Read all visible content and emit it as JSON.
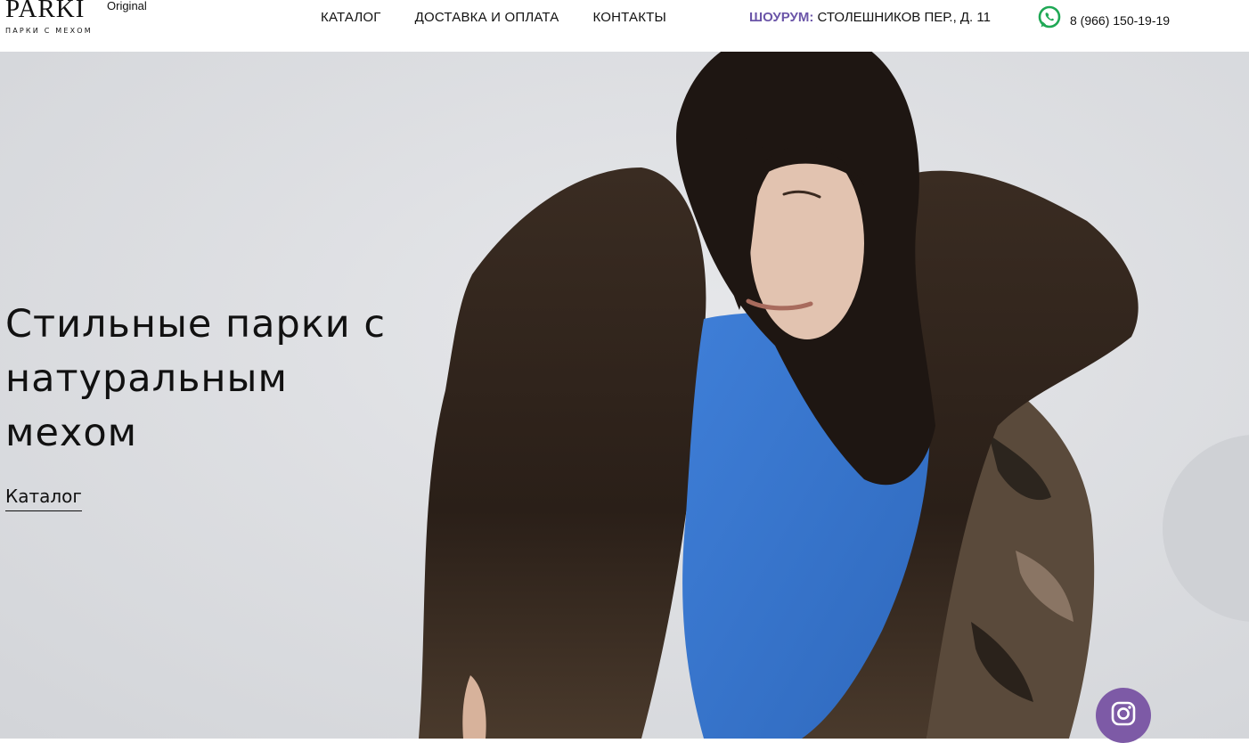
{
  "header": {
    "logo": {
      "name": "PARKI",
      "tagline": "ПАРКИ С МЕХОМ",
      "badge": "Original"
    },
    "nav": [
      {
        "label": "КАТАЛОГ"
      },
      {
        "label": "ДОСТАВКА И ОПЛАТА"
      },
      {
        "label": "КОНТАКТЫ"
      }
    ],
    "showroom": {
      "label": "ШОУРУМ:",
      "address": "СТОЛЕШНИКОВ ПЕР., Д. 11"
    },
    "phone": {
      "icon": "whatsapp-icon",
      "number": "8 (966) 150-19-19"
    }
  },
  "hero": {
    "title": "Стильные парки с натуральным мехом",
    "link_label": "Каталог",
    "image": "woman-in-fur-parka-photo"
  },
  "social": {
    "icon": "instagram-icon"
  },
  "colors": {
    "accent": "#6b55a8",
    "instagram_button": "#7d5aa6",
    "whatsapp": "#1fa855",
    "hero_background": "#dcdde0"
  }
}
